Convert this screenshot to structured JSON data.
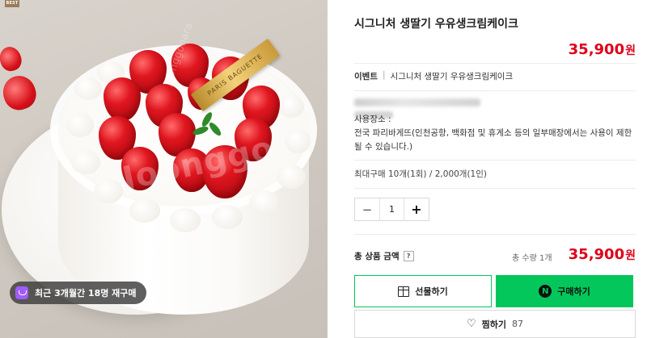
{
  "image": {
    "best_tag": "BEST",
    "plaque_text": "PARIS BAGUETTE",
    "watermark": "Joonggo",
    "watermark_small": "joonggonara",
    "repurchase_badge": "최근 3개월간 18명 재구매"
  },
  "product": {
    "title": "시그니처 생딸기 우유생크림케이크",
    "price": "35,900",
    "price_unit": "원",
    "event_label": "이벤트",
    "event_separator": "|",
    "event_value": "시그니처 생딸기 우유생크림케이크",
    "notice": "사용장소 :\n전국 파리바게뜨(인천공항, 백화점 및 휴게소 등의 일부매장에서는 사용이 제한될 수 있습니다.)",
    "max_purchase": "최대구매 10개(1회) / 2,000개(1인)"
  },
  "quantity": {
    "minus": "−",
    "value": "1",
    "plus": "+"
  },
  "total": {
    "label": "총 상품 금액",
    "help": "?",
    "quantity_text": "총 수량 1개",
    "price": "35,900",
    "price_unit": "원"
  },
  "buttons": {
    "gift_label": "선물하기",
    "buy_label": "구매하기",
    "buy_badge": "N",
    "wish_label": "찜하기",
    "wish_count": "87"
  },
  "colors": {
    "accent_green": "#03c75a",
    "price_red": "#e0001b"
  },
  "icons": [
    "gift-icon",
    "naver-pay-icon",
    "heart-icon",
    "help-icon",
    "repurchase-icon"
  ]
}
